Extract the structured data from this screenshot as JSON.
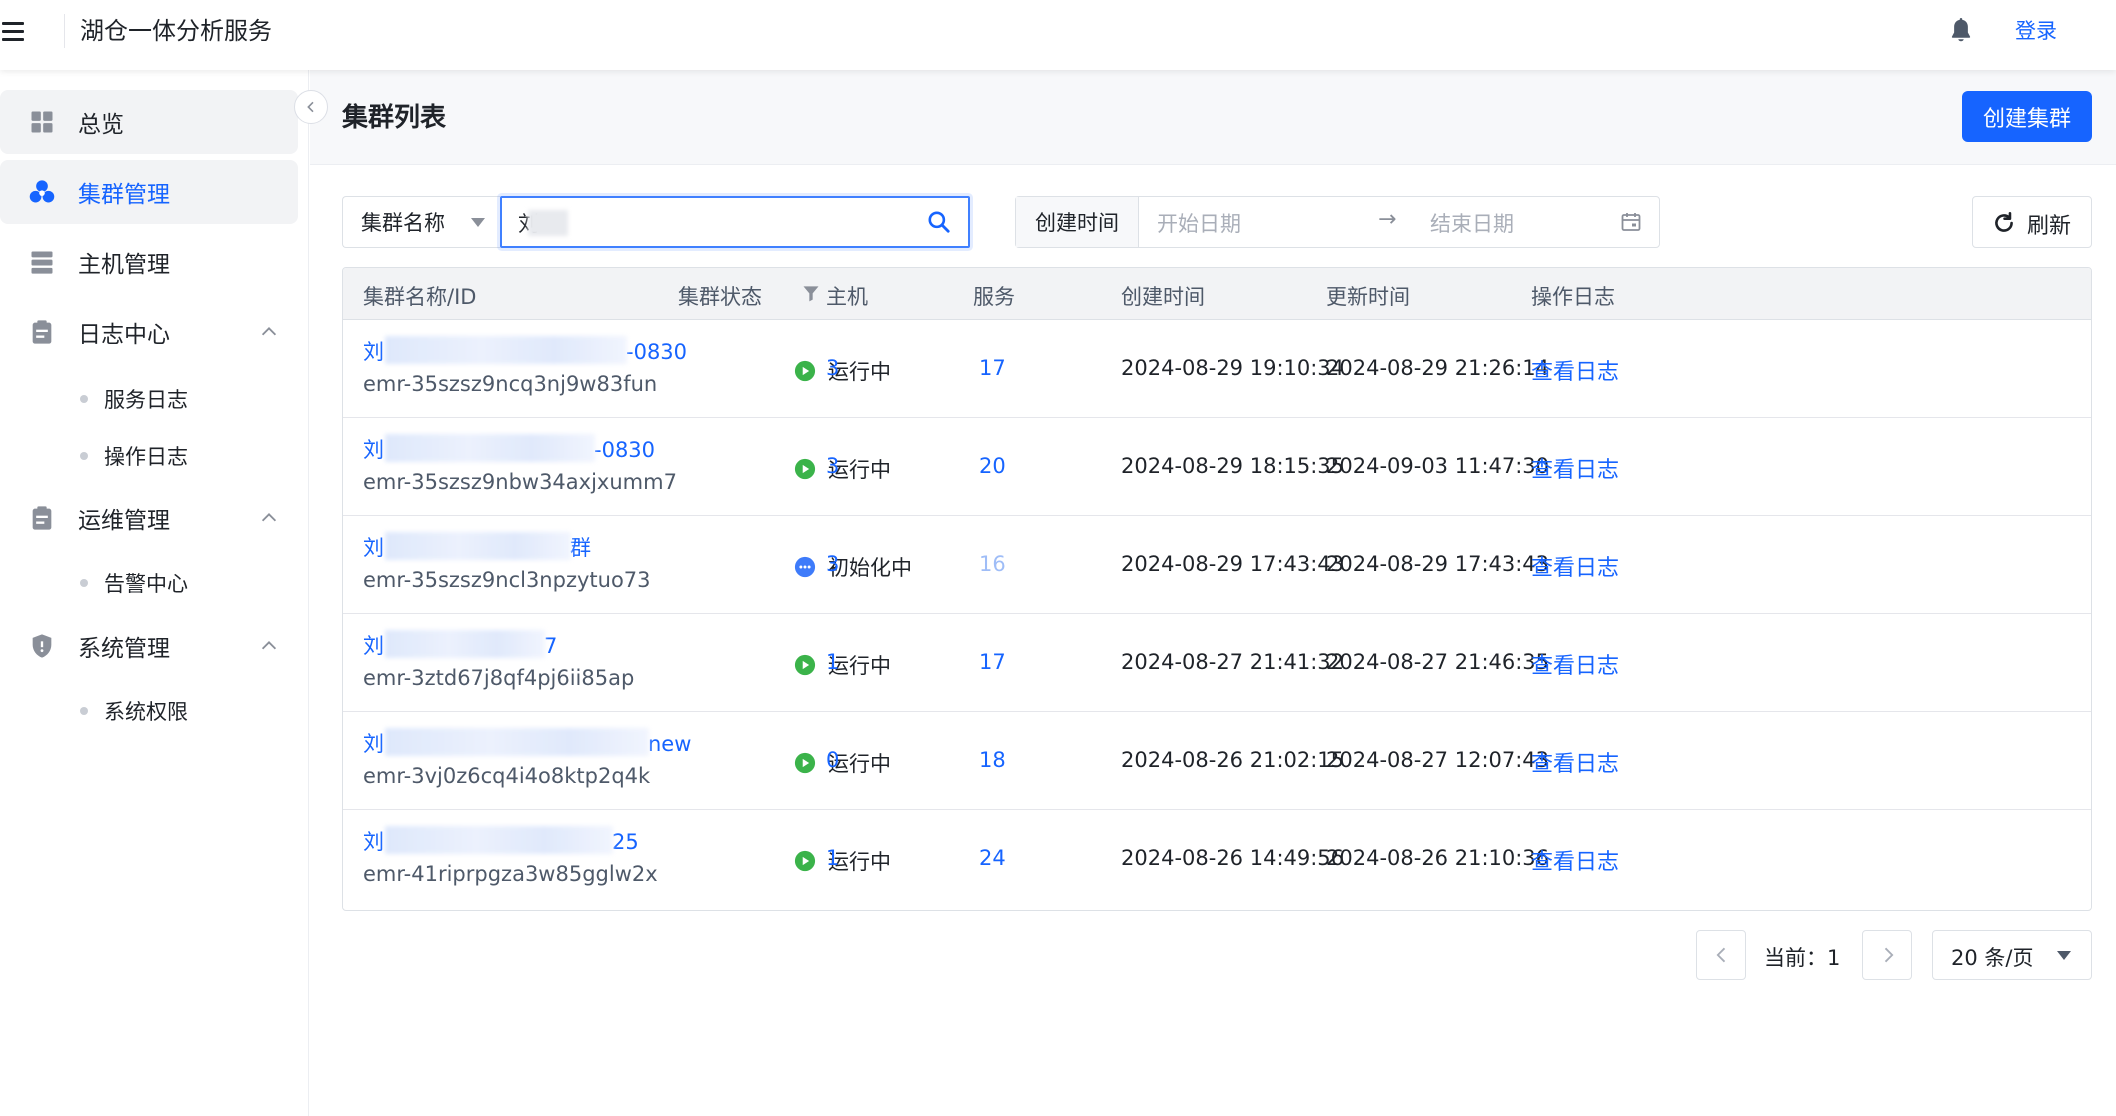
{
  "header": {
    "app_title": "湖仓一体分析服务",
    "login_label": "登录"
  },
  "sidebar": {
    "items": [
      {
        "label": "总览",
        "icon": "dashboard-icon"
      },
      {
        "label": "集群管理",
        "icon": "cluster-icon",
        "active": true
      },
      {
        "label": "主机管理",
        "icon": "server-icon"
      },
      {
        "label": "日志中心",
        "icon": "clipboard-icon",
        "children": [
          "服务日志",
          "操作日志"
        ]
      },
      {
        "label": "运维管理",
        "icon": "clipboard-icon",
        "children": [
          "告警中心"
        ]
      },
      {
        "label": "系统管理",
        "icon": "shield-icon",
        "children": [
          "系统权限"
        ]
      }
    ],
    "log_center": {
      "label": "日志中心",
      "sub1": "服务日志",
      "sub2": "操作日志"
    },
    "ops": {
      "label": "运维管理",
      "sub1": "告警中心"
    },
    "system": {
      "label": "系统管理",
      "sub1": "系统权限"
    },
    "overview": "总览",
    "cluster_mgmt": "集群管理",
    "host_mgmt": "主机管理"
  },
  "page": {
    "title": "集群列表",
    "create_label": "创建集群"
  },
  "filters": {
    "field_select": "集群名称",
    "search_value": "刘",
    "date_prefix": "创建时间",
    "start_placeholder": "开始日期",
    "arrow": "→",
    "end_placeholder": "结束日期",
    "refresh_label": "刷新"
  },
  "table": {
    "columns": {
      "name": "集群名称/ID",
      "status": "集群状态",
      "hosts": "主机",
      "services": "服务",
      "created": "创建时间",
      "updated": "更新时间",
      "log": "操作日志"
    },
    "rows": [
      {
        "name_prefix": "刘",
        "name_suffix": "-0830",
        "id": "emr-35szsz9ncq3nj9w83fun",
        "status": "运行中",
        "status_type": "running",
        "hosts": "3",
        "services": "17",
        "created": "2024-08-29 19:10:34",
        "updated": "2024-08-29 21:26:14",
        "log": "查看日志"
      },
      {
        "name_prefix": "刘",
        "name_suffix": "-0830",
        "id": "emr-35szsz9nbw34axjxumm7",
        "status": "运行中",
        "status_type": "running",
        "hosts": "3",
        "services": "20",
        "created": "2024-08-29 18:15:35",
        "updated": "2024-09-03 11:47:30",
        "log": "查看日志"
      },
      {
        "name_prefix": "刘",
        "name_suffix": "群",
        "id": "emr-35szsz9ncl3npzytuo73",
        "status": "初始化中",
        "status_type": "initializing",
        "hosts": "3",
        "services": "16",
        "created": "2024-08-29 17:43:43",
        "updated": "2024-08-29 17:43:43",
        "log": "查看日志"
      },
      {
        "name_prefix": "刘",
        "name_suffix": "7",
        "id": "emr-3ztd67j8qf4pj6ii85ap",
        "status": "运行中",
        "status_type": "running",
        "hosts": "1",
        "services": "17",
        "created": "2024-08-27 21:41:32",
        "updated": "2024-08-27 21:46:35",
        "log": "查看日志"
      },
      {
        "name_prefix": "刘",
        "name_suffix": "new",
        "id": "emr-3vj0z6cq4i4o8ktp2q4k",
        "status": "运行中",
        "status_type": "running",
        "hosts": "0",
        "services": "18",
        "created": "2024-08-26 21:02:15",
        "updated": "2024-08-27 12:07:43",
        "log": "查看日志"
      },
      {
        "name_prefix": "刘",
        "name_suffix": "25",
        "id": "emr-41riprpgza3w85gglw2x",
        "status": "运行中",
        "status_type": "running",
        "hosts": "1",
        "services": "24",
        "created": "2024-08-26 14:49:56",
        "updated": "2024-08-26 21:10:36",
        "log": "查看日志"
      }
    ]
  },
  "pagination": {
    "current_label": "当前：1",
    "page_size": "20 条/页"
  },
  "colors": {
    "primary": "#1664ff",
    "running": "#3bb34a",
    "initializing": "#3e7bfa"
  }
}
